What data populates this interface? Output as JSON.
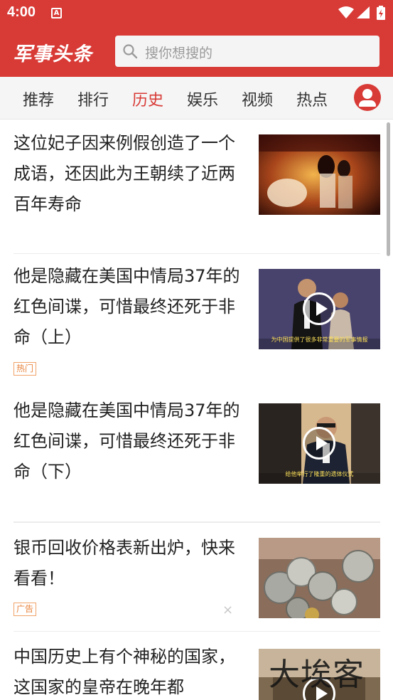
{
  "status_bar": {
    "time": "4:00",
    "notification_letter": "A"
  },
  "header": {
    "logo": "军事头条",
    "search_placeholder": "搜你想搜的"
  },
  "tabs": [
    {
      "label": "推荐"
    },
    {
      "label": "排行"
    },
    {
      "label": "历史",
      "active": true
    },
    {
      "label": "娱乐"
    },
    {
      "label": "视频"
    },
    {
      "label": "热点"
    }
  ],
  "feed": [
    {
      "title": "这位妃子因来例假创造了一个成语，还因此为王朝续了近两百年寿命",
      "is_video": false
    },
    {
      "title": "他是隐藏在美国中情局37年的红色间谍，可惜最终还死于非命（上）",
      "is_video": true,
      "tag": "热门",
      "caption": "为中国提供了很多非常重要的军事情报"
    },
    {
      "title": "他是隐藏在美国中情局37年的红色间谍，可惜最终还死于非命（下）",
      "is_video": true,
      "caption": "给他举行了隆重的遗体仪式"
    },
    {
      "title": "银币回收价格表新出炉，快来看看！",
      "is_video": false,
      "tag": "广告",
      "close": "×"
    },
    {
      "title": "中国历史上有个神秘的国家，这国家的皇帝在晚年都",
      "is_video": true
    }
  ],
  "watermark": "大埃客",
  "colors": {
    "brand_red": "#d83a36",
    "tag_orange": "#e8843d"
  }
}
